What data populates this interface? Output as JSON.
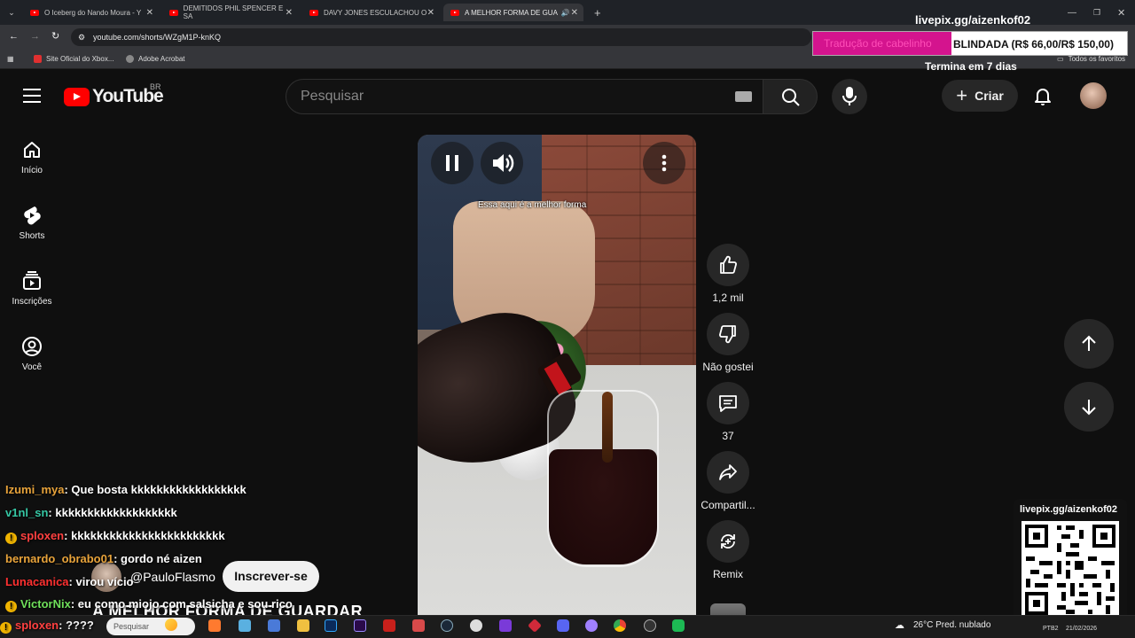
{
  "browser": {
    "tabs": [
      {
        "title": "O Iceberg do Nando Moura - Y"
      },
      {
        "title": "DEMITIDOS PHIL SPENCER E SA"
      },
      {
        "title": "DAVY JONES ESCULACHOU O"
      },
      {
        "title": "A MELHOR FORMA DE GUA"
      }
    ],
    "url": "youtube.com/shorts/WZgM1P-knKQ",
    "bookmarks": [
      "Site Oficial do Xbox...",
      "Adobe Acrobat"
    ],
    "all_bookmarks": "Todos os favoritos"
  },
  "overlay": {
    "livepix_top": "livepix.gg/aizenkof02",
    "goal_left": "Tradução de cabelinho",
    "goal_right": "BLINDADA (R$ 66,00/R$ 150,00)",
    "goal_progress": 0.44,
    "goal_sub": "Termina em 7 dias",
    "qr_label": "livepix.gg/aizenkof02"
  },
  "header": {
    "logo_text": "YouTube",
    "country": "BR",
    "search_placeholder": "Pesquisar",
    "create_label": "Criar"
  },
  "sidebar": {
    "items": [
      {
        "label": "Início",
        "icon": "home-icon"
      },
      {
        "label": "Shorts",
        "icon": "shorts-icon"
      },
      {
        "label": "Inscrições",
        "icon": "subscriptions-icon"
      },
      {
        "label": "Você",
        "icon": "you-icon"
      }
    ]
  },
  "short": {
    "caption": "Essa aqui é a melhor forma",
    "channel": "@PauloFlasmo",
    "subscribe": "Inscrever-se",
    "title": "A MELHOR FORMA DE GUARDAR",
    "actions": {
      "like_count": "1,2 mil",
      "dislike_label": "Não gostei",
      "comments_count": "37",
      "share_label": "Compartil...",
      "remix_label": "Remix"
    }
  },
  "chat": [
    {
      "user": "Izumi_mya",
      "color": "#e8a33a",
      "text": ": Que bosta kkkkkkkkkkkkkkkkkk",
      "warn": false
    },
    {
      "user": "v1nl_sn",
      "color": "#35c7a4",
      "text": ": kkkkkkkkkkkkkkkkkkk",
      "warn": false
    },
    {
      "user": "sploxen",
      "color": "#ff4040",
      "text": ": kkkkkkkkkkkkkkkkkkkkkkkk",
      "warn": true
    },
    {
      "user": "bernardo_obrabo01",
      "color": "#e8a33a",
      "text": ": gordo né aizen",
      "warn": false
    },
    {
      "user": "Lunacanica",
      "color": "#ff3030",
      "text": ": virou vício",
      "warn": false
    },
    {
      "user": "VictorNix",
      "color": "#6fe05a",
      "text": ": eu como miojo com salsicha e sou rico",
      "warn": true
    },
    {
      "user": "sploxen",
      "color": "#ff4040",
      "text": ": ????",
      "warn": true
    }
  ],
  "taskbar": {
    "search_placeholder": "Pesquisar",
    "weather": "26°C  Pred. nublado",
    "lang": "PTB2",
    "date": "21/02/2026"
  }
}
